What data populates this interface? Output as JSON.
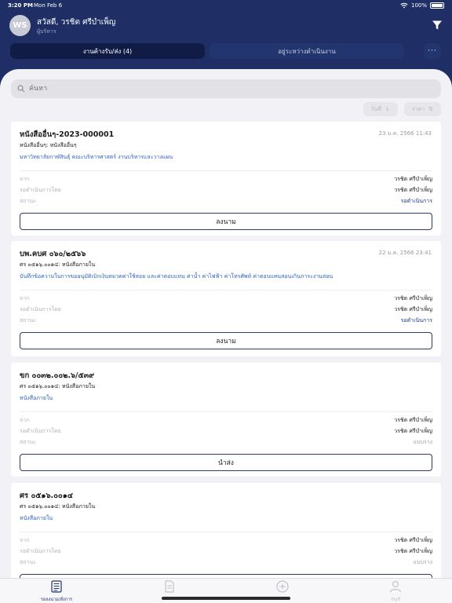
{
  "status_bar": {
    "time": "3:20 PM",
    "date": "Mon Feb 6",
    "battery": "100%"
  },
  "header": {
    "avatar_initials": "WS",
    "user_name": "สวัสดี, วรชิต ศรีบำเพ็ญ",
    "user_role": "ผู้บริหาร",
    "filter_icon": "filter-icon"
  },
  "tabs": [
    {
      "label": "งานค้างรับ/ส่ง (4)",
      "active": true
    },
    {
      "label": "อยู่ระหว่างดำเนินงาน",
      "active": false
    }
  ],
  "more_label": "···",
  "search": {
    "placeholder": "ค้นหา"
  },
  "sort": {
    "date_label": "วันที่",
    "date_icon": "↓",
    "price_label": "ราคา",
    "price_icon": "⇅"
  },
  "labels": {
    "from": "จาก",
    "waiting_by": "รอดำเนินการโดย",
    "status": "สถานะ"
  },
  "documents": [
    {
      "title": "หนังสืออื่นๆ-2023-000001",
      "date": "23 ม.ค. 2566 11:43",
      "subtitle": "หนังสืออื่นๆ: หนังสืออื่นๆ",
      "link": "มหาวิทยาลัยกาฬสินธุ์ คณะบริหารศาสตร์ งานบริหารและวางแผน",
      "from": "วรชิต ศรีบำเพ็ญ",
      "waiting_by": "วรชิต ศรีบำเพ็ญ",
      "status": "รอดำเนินการ",
      "status_type": "pending",
      "action": "ลงนาม"
    },
    {
      "title": "บพ.คบศ ๐๖๐/๒๕๖๖",
      "date": "22 ม.ค. 2566 23:41",
      "subtitle": "ศร ๐๕๑๖.๐๐๑๔: หนังสือภายใน",
      "link": "บันทึกข้อความในการขออนุมัติเบิกเงินหมวดค่าใช้สอย และค่าตอบแทน ค่าน้ำ ค่าไฟฟ้า ค่าโทรศัพท์ ค่าตอบแทนสอนเกินภาระงานสอน",
      "from": "วรชิต ศรีบำเพ็ญ",
      "waiting_by": "วรชิต ศรีบำเพ็ญ",
      "status": "รอดำเนินการ",
      "status_type": "pending",
      "action": "ลงนาม"
    },
    {
      "title": "ขก ๐๐๓๒.๐๐๒.๖/๕๓๙",
      "date": "",
      "subtitle": "ศร ๐๕๑๖.๐๐๑๔: หนังสือภายใน",
      "link": "หนังสือภายใน",
      "from": "วรชิต ศรีบำเพ็ญ",
      "waiting_by": "วรชิต ศรีบำเพ็ญ",
      "status": "แบบร่าง",
      "status_type": "draft",
      "action": "นำส่ง"
    },
    {
      "title": "ศร ๐๕๑๖.๐๐๑๔",
      "date": "",
      "subtitle": "ศร ๐๕๑๖.๐๐๑๔: หนังสือภายใน",
      "link": "หนังสือภายใน",
      "from": "วรชิต ศรีบำเพ็ญ",
      "waiting_by": "วรชิต ศรีบำเพ็ญ",
      "status": "แบบร่าง",
      "status_type": "draft",
      "action": ""
    }
  ],
  "bottom_tabs": [
    {
      "label": "รอลงนาม/สั่งการ",
      "icon": "document-list-icon",
      "active": true
    },
    {
      "label": "",
      "icon": "document-icon",
      "active": false
    },
    {
      "label": "",
      "icon": "plus-circle-icon",
      "active": false
    },
    {
      "label": "บัญชี",
      "icon": "person-icon",
      "active": false
    }
  ]
}
